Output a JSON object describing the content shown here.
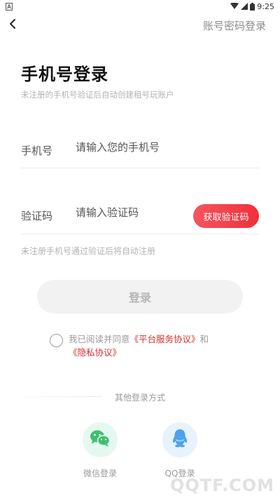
{
  "status_bar": {
    "time": "9:25",
    "left_icon": "a-notification-icon"
  },
  "nav": {
    "back_icon": "chevron-left-icon",
    "switch_login": "账号密码登录"
  },
  "header": {
    "title": "手机号登录",
    "subtitle": "未注册的手机号验证后自动创建租号玩账户"
  },
  "phone": {
    "label": "手机号",
    "placeholder": "请输入您的手机号",
    "value": ""
  },
  "code": {
    "label": "验证码",
    "placeholder": "请输入验证码",
    "value": "",
    "get_code": "获取验证码"
  },
  "hint": "未注册手机号通过验证后将自动注册",
  "login_button": "登录",
  "agreement": {
    "checked": false,
    "prefix": "我已阅读并同意",
    "service_link": "《平台服务协议》",
    "conjunction": "和",
    "privacy_link": "《隐私协议》"
  },
  "other_login": {
    "title": "其他登录方式",
    "wechat": {
      "label": "微信登录",
      "icon": "wechat-icon"
    },
    "qq": {
      "label": "QQ登录",
      "icon": "qq-icon"
    }
  },
  "watermark": "QQTF.COM",
  "colors": {
    "accent": "#f0303b",
    "link": "#d0302d",
    "wechat": "#3fbf72",
    "qq": "#4ba3f0"
  }
}
